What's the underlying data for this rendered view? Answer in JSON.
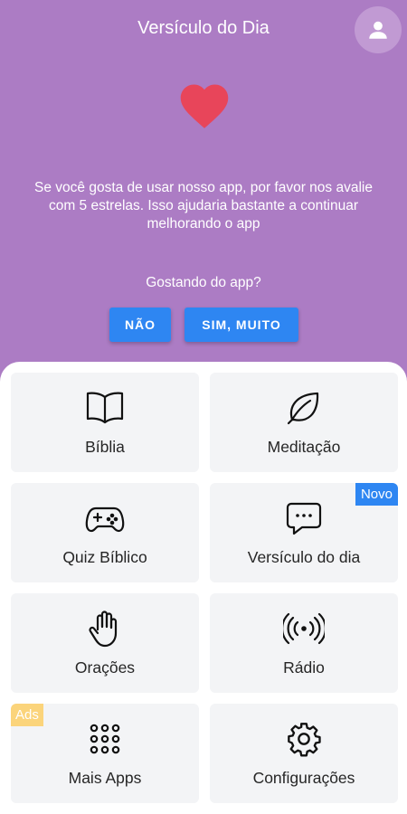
{
  "header": {
    "title": "Versículo do Dia",
    "message": "Se você gosta de usar nosso app, por favor nos avalie com 5 estrelas. Isso ajudaria bastante a continuar melhorando o app",
    "question": "Gostando do app?",
    "no_label": "NÃO",
    "yes_label": "SIM, MUITO",
    "heart_color": "#e8455a",
    "background_color": "#ac7cc4"
  },
  "grid": {
    "items": [
      {
        "label": "Bíblia",
        "icon": "book-icon"
      },
      {
        "label": "Meditação",
        "icon": "leaf-icon"
      },
      {
        "label": "Quiz Bíblico",
        "icon": "gamepad-icon"
      },
      {
        "label": "Versículo do dia",
        "icon": "chat-icon",
        "badge": "Novo"
      },
      {
        "label": "Orações",
        "icon": "hand-icon"
      },
      {
        "label": "Rádio",
        "icon": "radio-icon"
      },
      {
        "label": "Mais Apps",
        "icon": "apps-grid-icon",
        "badge": "Ads"
      },
      {
        "label": "Configurações",
        "icon": "gear-icon"
      }
    ]
  }
}
